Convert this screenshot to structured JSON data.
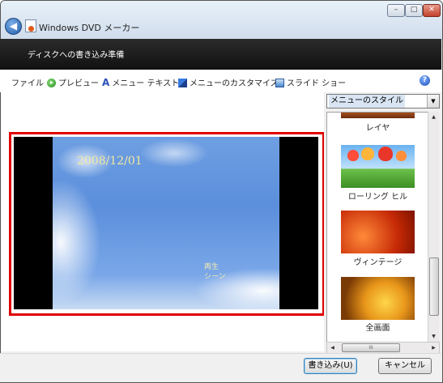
{
  "window": {
    "title": "Windows DVD メーカー",
    "controls": {
      "minimize": "–",
      "maximize": "□",
      "close": "✕"
    }
  },
  "header": {
    "title": "ディスクへの書き込み準備"
  },
  "toolbar": {
    "file": "ファイル",
    "preview": "プレビュー",
    "menu_text": "メニュー テキスト",
    "customize": "メニューのカスタマイズ",
    "slideshow": "スライド ショー",
    "help": "?"
  },
  "preview": {
    "date": "2008/12/01",
    "menu_play": "再生",
    "menu_scenes": "シーン"
  },
  "menu_styles": {
    "dropdown_label": "メニューのスタイル",
    "items": [
      {
        "label": "レイヤ"
      },
      {
        "label": "ローリング ヒル"
      },
      {
        "label": "ヴィンテージ"
      },
      {
        "label": "全画面"
      }
    ],
    "scroll_glyph": "III"
  },
  "footer": {
    "write_button": "書き込み(U)",
    "cancel_button": "キャンセル"
  }
}
